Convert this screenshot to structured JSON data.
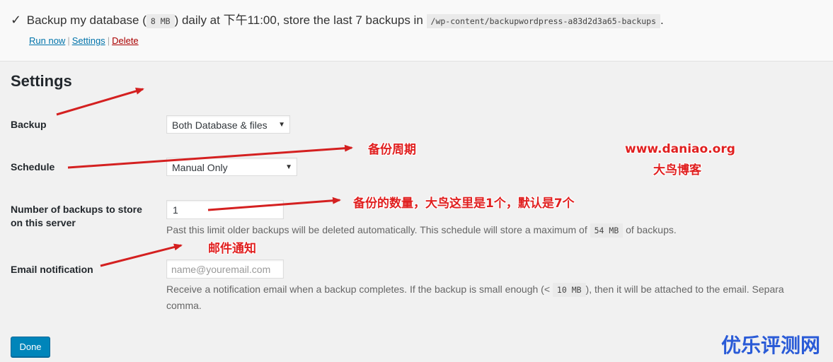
{
  "schedule": {
    "check_icon": "checkmark",
    "text_before": "Backup my database (",
    "db_size": "8 MB",
    "text_after_size": ") daily at 下午11:00, store the last 7 backups in",
    "path": "/wp-content/backupwordpress-a83d2d3a65-backups",
    "text_end": "."
  },
  "actions": {
    "run_now": "Run now",
    "settings": "Settings",
    "delete": "Delete",
    "separator": "|"
  },
  "settings": {
    "title": "Settings",
    "backup": {
      "label": "Backup",
      "value": "Both Database & files"
    },
    "schedule": {
      "label": "Schedule",
      "value": "Manual Only"
    },
    "store": {
      "label_line1": "Number of backups to store",
      "label_line2": "on this server",
      "value": "1",
      "help_before": "Past this limit older backups will be deleted automatically. This schedule will store a maximum of",
      "help_size": "54 MB",
      "help_after": "of backups."
    },
    "email": {
      "label": "Email notification",
      "placeholder": "name@youremail.com",
      "help_before": "Receive a notification email when a backup completes. If the backup is small enough (<",
      "help_size": "10 MB",
      "help_after": "), then it will be attached to the email. Separa",
      "help_line2": "comma."
    },
    "done": "Done"
  },
  "annotations": {
    "schedule_note": "备份周期",
    "count_note": "备份的数量，大鸟这里是1个，默认是7个",
    "email_note": "邮件通知",
    "site_url": "www.daniao.org",
    "site_name": "大鸟博客"
  },
  "watermark": "优乐评测网",
  "colors": {
    "annotation": "#e02020",
    "primary": "#0085ba",
    "link": "#0073aa",
    "delete": "#a00000"
  }
}
